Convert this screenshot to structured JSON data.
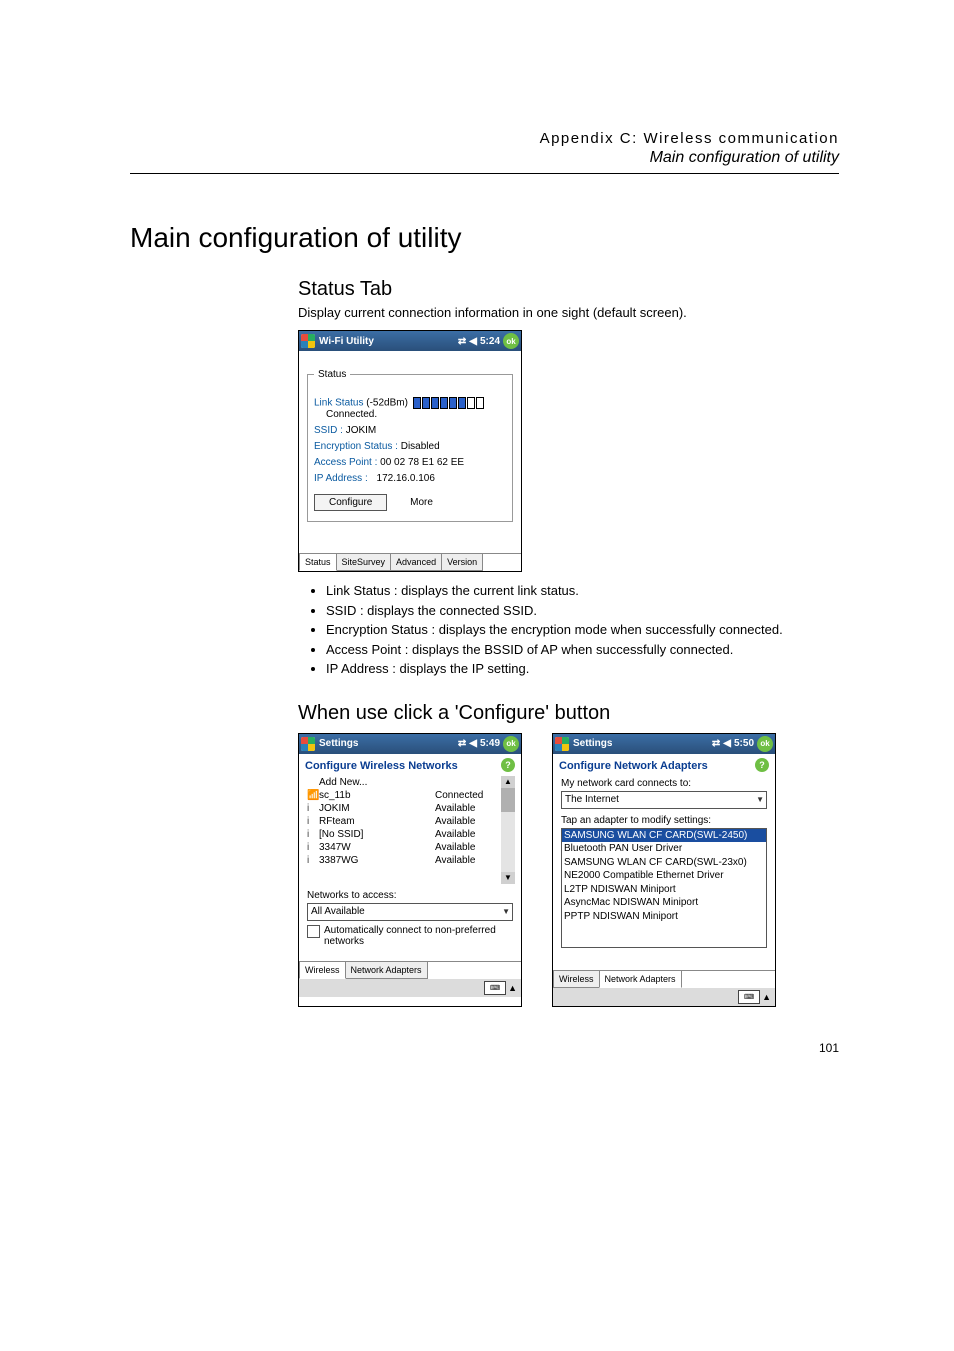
{
  "header": {
    "appendix": "Appendix C: Wireless communication",
    "subtitle": "Main configuration of utility"
  },
  "title": "Main configuration of utility",
  "status_tab": {
    "heading": "Status Tab",
    "lead": "Display current connection information in one sight (default screen).",
    "bullets": [
      "Link Status : displays the current link status.",
      "SSID : displays the connected SSID.",
      "Encryption Status : displays the encryption mode when successfully connected.",
      "Access Point : displays the BSSID of AP when successfully connected.",
      "IP Address : displays the IP setting."
    ]
  },
  "wm_status": {
    "title": "Wi-Fi Utility",
    "time": "5:24",
    "ok": "ok",
    "frame_legend": "Status",
    "link_status_label": "Link Status",
    "signal_text": "(-52dBm)",
    "connected": "Connected.",
    "ssid_label": "SSID :",
    "ssid_value": "JOKIM",
    "enc_label": "Encryption Status :",
    "enc_value": "Disabled",
    "ap_label": "Access Point :",
    "ap_value": "00 02 78 E1 62 EE",
    "ip_label": "IP Address :",
    "ip_value": "172.16.0.106",
    "btn_configure": "Configure",
    "btn_more": "More",
    "tabs": [
      "Status",
      "SiteSurvey",
      "Advanced",
      "Version"
    ]
  },
  "configure_heading": "When use click a 'Configure' button",
  "wm_wireless": {
    "title": "Settings",
    "time": "5:49",
    "ok": "ok",
    "section": "Configure Wireless Networks",
    "networks": [
      {
        "icon": "",
        "name": "Add New...",
        "status": ""
      },
      {
        "icon": "📶",
        "name": "sc_11b",
        "status": "Connected"
      },
      {
        "icon": "i",
        "name": "JOKIM",
        "status": "Available"
      },
      {
        "icon": "i",
        "name": "RFteam",
        "status": "Available"
      },
      {
        "icon": "i",
        "name": "[No SSID]",
        "status": "Available"
      },
      {
        "icon": "i",
        "name": "3347W",
        "status": "Available"
      },
      {
        "icon": "i",
        "name": "3387WG",
        "status": "Available"
      }
    ],
    "access_label": "Networks to access:",
    "access_value": "All Available",
    "auto_connect": "Automatically connect to non-preferred networks",
    "tabs": [
      "Wireless",
      "Network Adapters"
    ]
  },
  "wm_adapters": {
    "title": "Settings",
    "time": "5:50",
    "ok": "ok",
    "section": "Configure Network Adapters",
    "connects_label": "My network card connects to:",
    "connects_value": "The Internet",
    "tap_label": "Tap an adapter to modify settings:",
    "adapters": [
      "SAMSUNG WLAN CF CARD(SWL-2450)",
      "Bluetooth PAN User Driver",
      "SAMSUNG WLAN CF CARD(SWL-23x0)",
      "NE2000 Compatible Ethernet Driver",
      "L2TP NDISWAN Miniport",
      "AsyncMac NDISWAN Miniport",
      "PPTP NDISWAN Miniport"
    ],
    "tabs": [
      "Wireless",
      "Network Adapters"
    ]
  },
  "page_num": "101"
}
